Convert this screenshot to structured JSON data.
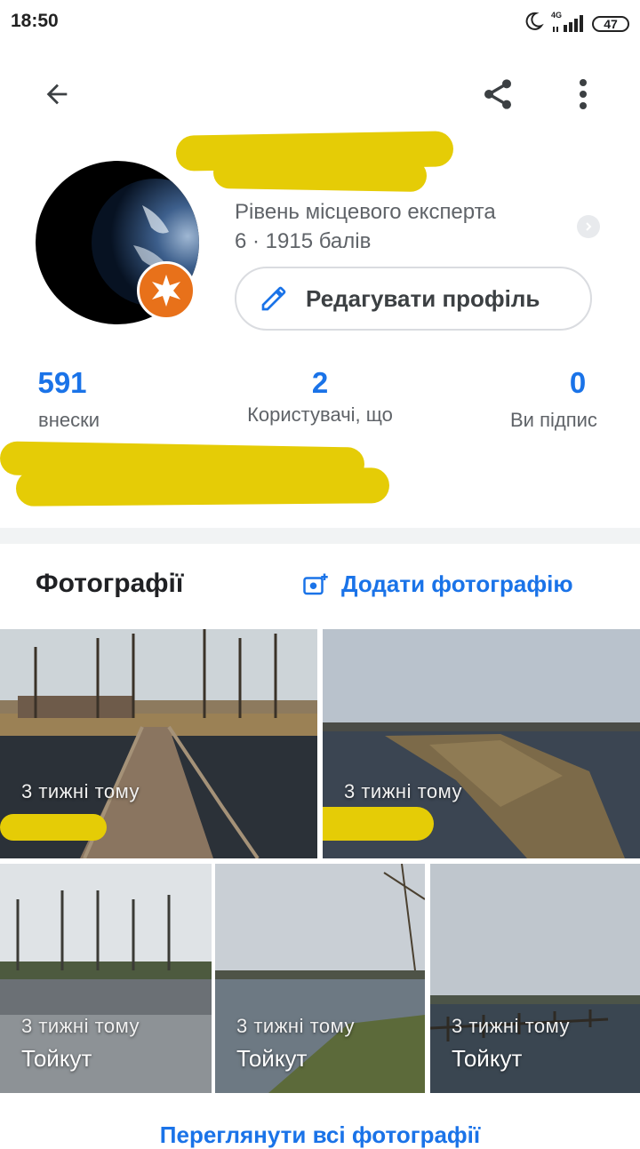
{
  "status_bar": {
    "time": "18:50",
    "network": "4G",
    "battery": "47",
    "icons": [
      "moon-icon",
      "signal-icon",
      "battery-icon"
    ]
  },
  "toolbar": {
    "back_icon": "arrow-left-icon",
    "share_icon": "share-icon",
    "menu_icon": "more-vert-icon"
  },
  "profile": {
    "level_label": "Рівень місцевого експерта",
    "level_points": "6 · 1915 балів",
    "edit_button": "Редагувати профіль",
    "badge_color": "#e8711a"
  },
  "stats": [
    {
      "value": "591",
      "label": "внески"
    },
    {
      "value": "2",
      "label": "Користувачі, що"
    },
    {
      "value": "0",
      "label": "Ви підпис"
    }
  ],
  "photos": {
    "title": "Фотографії",
    "add_label": "Додати фотографію",
    "view_all": "Переглянути всі фотографії",
    "tiles": [
      {
        "time": "3 тижні тому",
        "name": ""
      },
      {
        "time": "3 тижні тому",
        "name": ""
      },
      {
        "time": "3 тижні тому",
        "name": "Тойкут"
      },
      {
        "time": "3 тижні тому",
        "name": "Тойкут"
      },
      {
        "time": "3 тижні тому",
        "name": "Тойкут"
      }
    ]
  },
  "colors": {
    "accent": "#1a73e8",
    "redaction": "#e5cc06",
    "divider": "#f1f3f4"
  }
}
